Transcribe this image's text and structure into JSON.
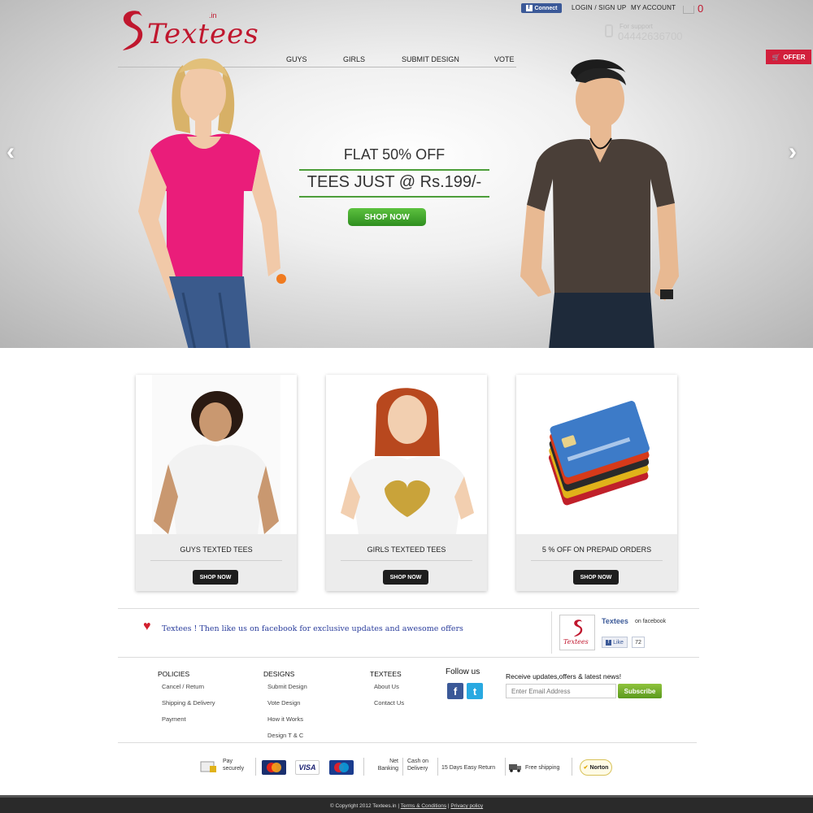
{
  "header": {
    "logo_text": "Textees",
    "logo_suffix": ".in",
    "fb_connect_label": "Connect",
    "login_label": "LOGIN / SIGN UP",
    "account_label": "MY ACCOUNT",
    "cart_count": "0",
    "support_label": "For support",
    "phone": "04442636700",
    "offer_label": "OFFER"
  },
  "nav": [
    "GUYS",
    "GIRLS",
    "SUBMIT DESIGN",
    "VOTE"
  ],
  "hero": {
    "promo_line1": "FLAT 50% OFF",
    "promo_line2": "TEES JUST @ Rs.199/-",
    "cta_label": "SHOP NOW"
  },
  "cards": [
    {
      "title": "GUYS TEXTED TEES",
      "button": "SHOP NOW"
    },
    {
      "title": "GIRLS TEXTEED TEES",
      "button": "SHOP NOW"
    },
    {
      "title": "5 % OFF ON PREPAID ORDERS",
      "button": "SHOP NOW"
    }
  ],
  "facebook": {
    "message": "Textees ! Then like us on facebook for exclusive updates and awesome offers",
    "page_name": "Textees",
    "on_label": "on facebook",
    "like_label": "Like",
    "like_count": "72"
  },
  "footer": {
    "policies": {
      "heading": "POLICIES",
      "links": [
        "Cancel / Return",
        "Shipping & Delivery",
        "Payment"
      ]
    },
    "designs": {
      "heading": "DESIGNS",
      "links": [
        "Submit Design",
        "Vote Design",
        "How it Works",
        "Design T & C"
      ]
    },
    "textees": {
      "heading": "TEXTEES",
      "links": [
        "About Us",
        "Contact Us"
      ]
    },
    "follow_label": "Follow us",
    "newsletter_label": "Receive updates,offers & latest news!",
    "email_placeholder": "Enter Email Address",
    "subscribe_label": "Subscribe"
  },
  "payment": {
    "pay_securely": "Pay securely",
    "net_banking": "Net Banking",
    "cash_on_delivery": "Cash on Delivery",
    "easy_return": "15 Days Easy Return",
    "free_shipping": "Free shipping",
    "norton": "Norton"
  },
  "copyright": {
    "text": "© Copyright 2012 Textees.in |",
    "terms": "Terms & Conditions",
    "privacy": "Privacy policy"
  }
}
